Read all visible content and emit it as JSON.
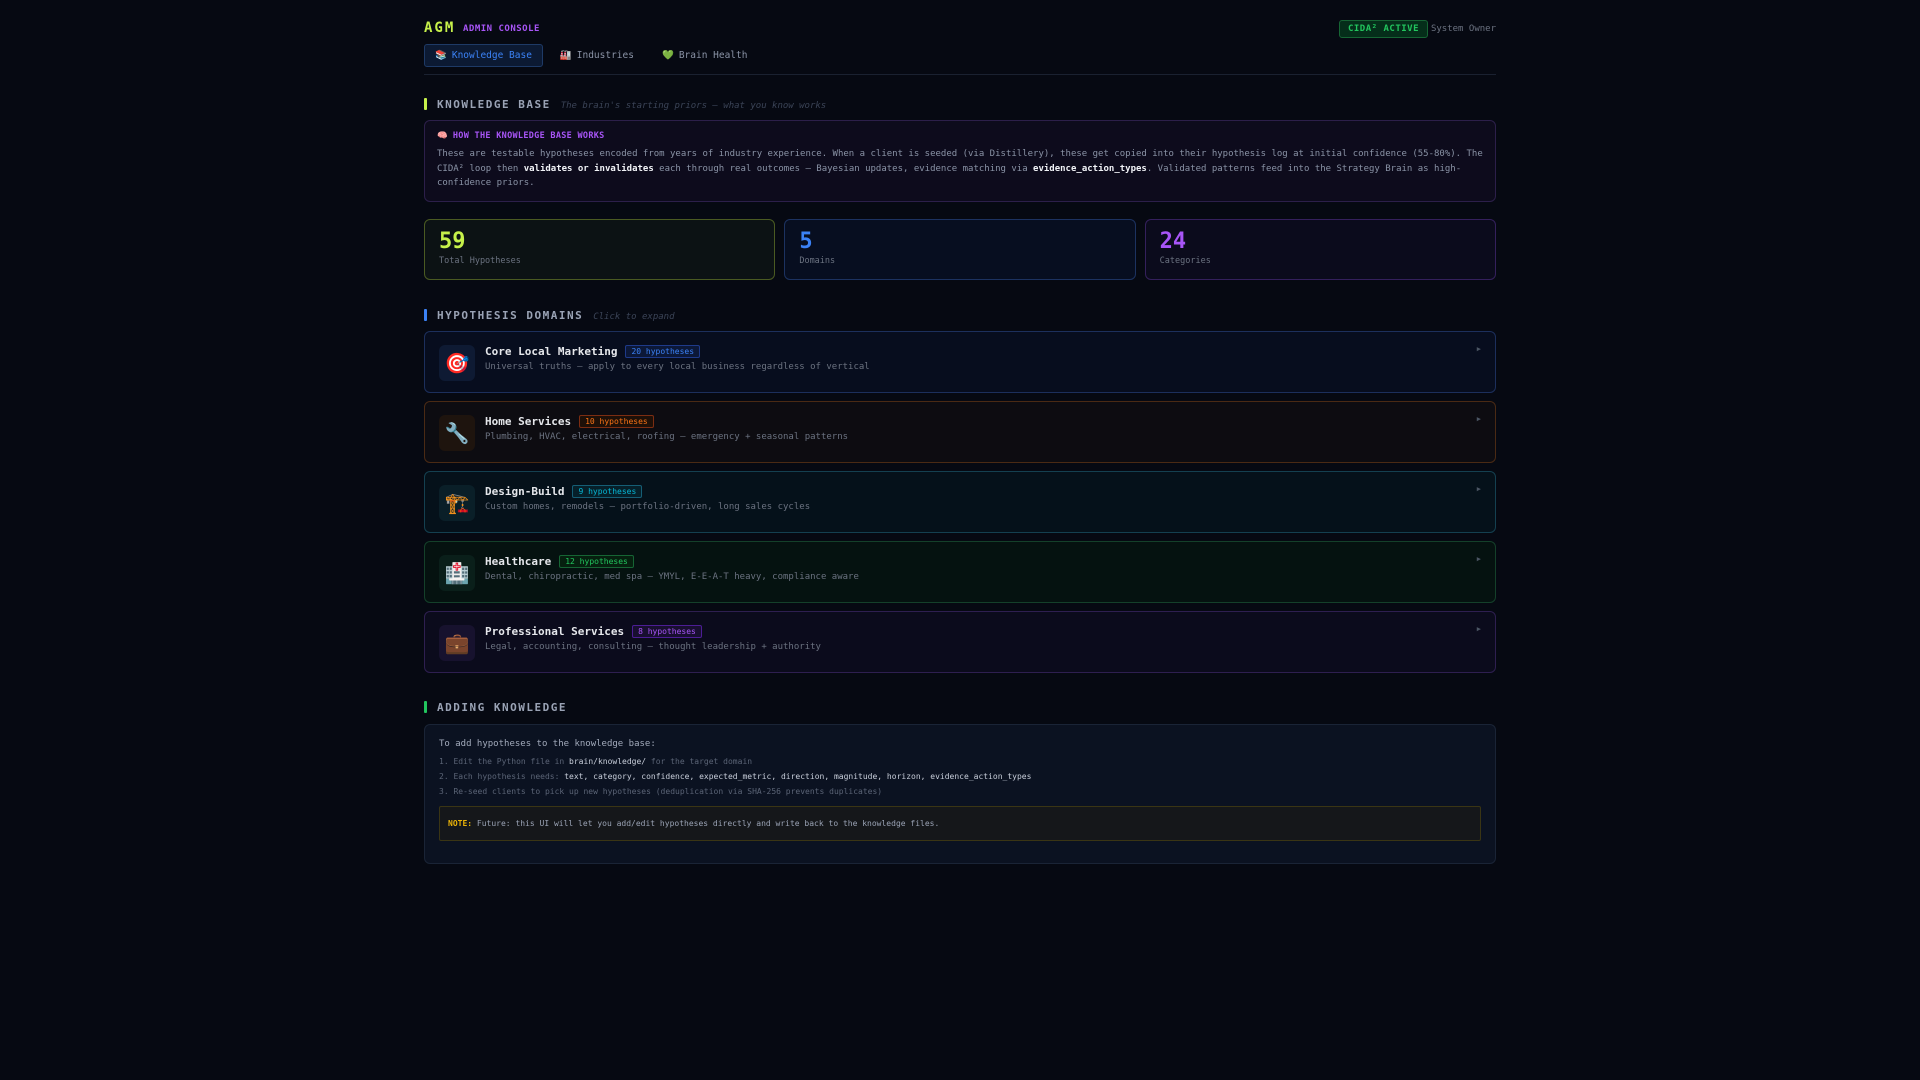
{
  "header": {
    "logo": "AGM",
    "subtitle": "ADMIN CONSOLE",
    "status_badge": "CIDA² ACTIVE",
    "user": "System Owner"
  },
  "tabs": [
    {
      "icon": "📚",
      "label": "Knowledge Base"
    },
    {
      "icon": "🏭",
      "label": "Industries"
    },
    {
      "icon": "💚",
      "label": "Brain Health"
    }
  ],
  "kb": {
    "title": "KNOWLEDGE BASE",
    "hint": "The brain's starting priors — what you know works",
    "info_icon": "🧠",
    "info_title": "HOW THE KNOWLEDGE BASE WORKS",
    "info_p1": "These are testable hypotheses encoded from years of industry experience. When a client is seeded (via Distillery), these get copied into their hypothesis log at initial confidence (55-80%). The CIDA² loop then ",
    "info_b1": "validates or invalidates",
    "info_p2": " each through real outcomes — Bayesian updates, evidence matching via ",
    "info_b2": "evidence_action_types",
    "info_p3": ". Validated patterns feed into the Strategy Brain as high-confidence priors."
  },
  "stats": [
    {
      "value": "59",
      "label": "Total Hypotheses",
      "color": "#c6f04a"
    },
    {
      "value": "5",
      "label": "Domains",
      "color": "#3b82f6"
    },
    {
      "value": "24",
      "label": "Categories",
      "color": "#a855f7"
    }
  ],
  "domains_section": {
    "title": "HYPOTHESIS DOMAINS",
    "hint": "Click to expand"
  },
  "domains": [
    {
      "icon": "🎯",
      "name": "Core Local Marketing",
      "count": "20 hypotheses",
      "desc": "Universal truths — apply to every local business regardless of vertical",
      "color": "#3b82f6"
    },
    {
      "icon": "🔧",
      "name": "Home Services",
      "count": "10 hypotheses",
      "desc": "Plumbing, HVAC, electrical, roofing — emergency + seasonal patterns",
      "color": "#f97316"
    },
    {
      "icon": "🏗️",
      "name": "Design-Build",
      "count": "9 hypotheses",
      "desc": "Custom homes, remodels — portfolio-driven, long sales cycles",
      "color": "#06b6d4"
    },
    {
      "icon": "🏥",
      "name": "Healthcare",
      "count": "12 hypotheses",
      "desc": "Dental, chiropractic, med spa — YMYL, E-E-A-T heavy, compliance aware",
      "color": "#22c55e"
    },
    {
      "icon": "💼",
      "name": "Professional Services",
      "count": "8 hypotheses",
      "desc": "Legal, accounting, consulting — thought leadership + authority",
      "color": "#a855f7"
    }
  ],
  "adding": {
    "title": "ADDING KNOWLEDGE",
    "lead": "To add hypotheses to the knowledge base:",
    "s1a": "1. Edit the Python file in ",
    "s1b": "brain/knowledge/",
    "s1c": " for the target domain",
    "s2a": "2. Each hypothesis needs: ",
    "s2b": "text, category, confidence, expected_metric, direction, magnitude, horizon, evidence_action_types",
    "s3": "3. Re-seed clients to pick up new hypotheses (deduplication via SHA-256 prevents duplicates)",
    "note_label": "NOTE:",
    "note": " Future: this UI will let you add/edit hypotheses directly and write back to the knowledge files."
  }
}
